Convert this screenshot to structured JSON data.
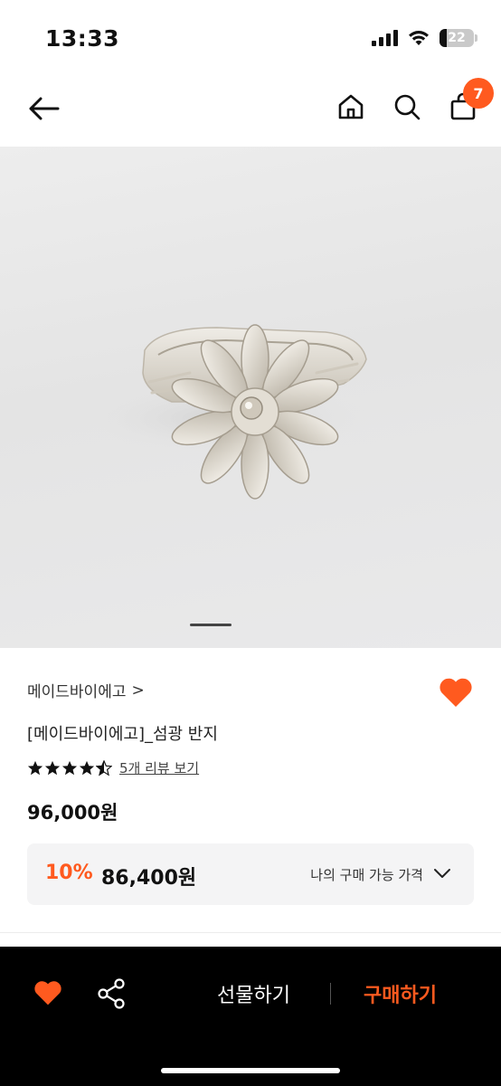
{
  "status_bar": {
    "time": "13:33",
    "battery": "22"
  },
  "nav": {
    "cart_count": "7"
  },
  "product": {
    "brand": "메이드바이에고",
    "brand_chevron": ">",
    "name": "[메이드바이에고]_섬광 반지",
    "rating_stars": 4.5,
    "review_link": "5개 리뷰 보기",
    "price": "96,000원"
  },
  "discount": {
    "rate": "10%",
    "price": "86,400원",
    "label": "나의 구매 가능 가격"
  },
  "bottom_bar": {
    "gift_label": "선물하기",
    "buy_label": "구매하기"
  },
  "colors": {
    "accent": "#ff5a1f",
    "bottom_bar": "#000000"
  }
}
